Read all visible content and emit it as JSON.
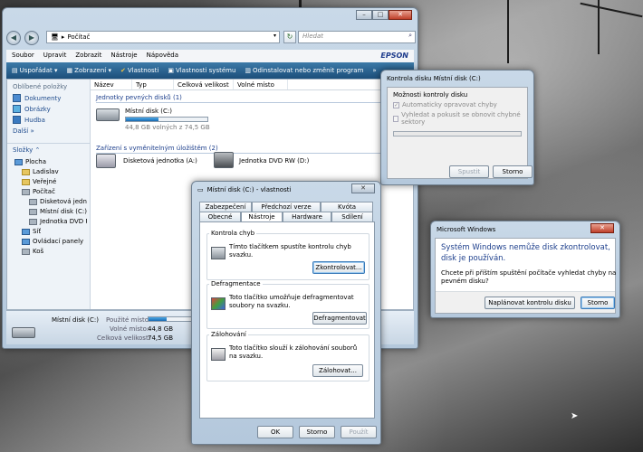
{
  "explorer": {
    "address": "Počítač",
    "search_placeholder": "Hledat",
    "menu": [
      "Soubor",
      "Upravit",
      "Zobrazit",
      "Nástroje",
      "Nápověda"
    ],
    "brand": "EPSON",
    "toolbar": {
      "organize": "Uspořádat",
      "views": "Zobrazení",
      "properties": "Vlastnosti",
      "system_properties": "Vlastnosti systému",
      "uninstall": "Odinstalovat nebo změnit program"
    },
    "favorites_head": "Oblíbené položky",
    "favorites": [
      "Dokumenty",
      "Obrázky",
      "Hudba"
    ],
    "more": "Další",
    "folders_head": "Složky",
    "tree": [
      "Plocha",
      "Ladislav",
      "Veřejné",
      "Počítač",
      "Disketová jednotka",
      "Místní disk (C:)",
      "Jednotka DVD RW",
      "Síť",
      "Ovládací panely",
      "Koš"
    ],
    "columns": [
      "Název",
      "Typ",
      "Celková velikost",
      "Volné místo"
    ],
    "group_hdd": "Jednotky pevných disků (1)",
    "group_removable": "Zařízení s vyměnitelným úložištěm (2)",
    "drive_c_name": "Místní disk (C:)",
    "drive_c_free": "44,8 GB volných z 74,5 GB",
    "drive_c_used_fraction": 0.4,
    "floppy_name": "Disketová jednotka (A:)",
    "dvd_name": "Jednotka DVD RW (D:)",
    "status": {
      "name": "Místní disk (C:)",
      "used_label": "Použité místo:",
      "free_label": "Volné místo:",
      "free_value": "44,8 GB",
      "total_label": "Celková velikost:",
      "total_value": "74,5 GB"
    }
  },
  "props": {
    "title": "Místní disk (C:) - vlastnosti",
    "tabs_top": [
      "Zabezpečení",
      "Předchozí verze",
      "Kvóta"
    ],
    "tabs_bottom": [
      "Obecné",
      "Nástroje",
      "Hardware",
      "Sdílení"
    ],
    "check_head": "Kontrola chyb",
    "check_text": "Tímto tlačítkem spustíte kontrolu chyb svazku.",
    "check_btn": "Zkontrolovat...",
    "defrag_head": "Defragmentace",
    "defrag_text": "Toto tlačítko umožňuje defragmentovat soubory na svazku.",
    "defrag_btn": "Defragmentovat",
    "backup_head": "Zálohování",
    "backup_text": "Toto tlačítko slouží k zálohování souborů na svazku.",
    "backup_btn": "Zálohovat...",
    "ok": "OK",
    "cancel": "Storno",
    "apply": "Použít"
  },
  "check": {
    "title": "Kontrola disku Místní disk (C:)",
    "group": "Možnosti kontroly disku",
    "opt1": "Automaticky opravovat chyby",
    "opt2": "Vyhledat a pokusit se obnovit chybné sektory",
    "start": "Spustit",
    "cancel": "Storno"
  },
  "msg": {
    "title": "Microsoft Windows",
    "heading": "Systém Windows nemůže disk zkontrolovat, disk je používán.",
    "text": "Chcete při příštím spuštění počítače vyhledat chyby na pevném disku?",
    "schedule": "Naplánovat kontrolu disku",
    "cancel": "Storno"
  }
}
